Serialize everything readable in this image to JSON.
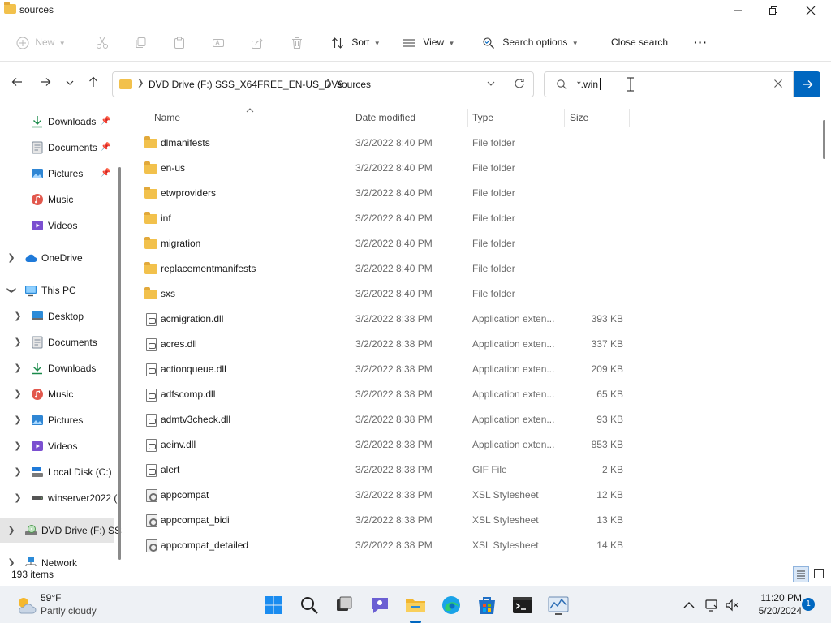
{
  "window": {
    "title": "sources"
  },
  "toolbar": {
    "new_label": "New",
    "sort_label": "Sort",
    "view_label": "View",
    "search_options_label": "Search options",
    "close_search_label": "Close search",
    "more_label": "···"
  },
  "address": {
    "crumbs": [
      "DVD Drive (F:) SSS_X64FREE_EN-US_DV9",
      "sources"
    ]
  },
  "search": {
    "value": "*.win"
  },
  "nav": {
    "items": [
      {
        "label": "Downloads",
        "icon": "download-arrow-icon",
        "pinned": true
      },
      {
        "label": "Documents",
        "icon": "documents-icon",
        "pinned": true
      },
      {
        "label": "Pictures",
        "icon": "pictures-icon",
        "pinned": true
      },
      {
        "label": "Music",
        "icon": "music-icon"
      },
      {
        "label": "Videos",
        "icon": "videos-icon"
      },
      {
        "label": "OneDrive",
        "icon": "cloud-icon"
      },
      {
        "label": "This PC",
        "icon": "monitor-icon"
      },
      {
        "label": "Desktop",
        "icon": "desktop-icon"
      },
      {
        "label": "Documents",
        "icon": "documents-icon"
      },
      {
        "label": "Downloads",
        "icon": "download-arrow-icon"
      },
      {
        "label": "Music",
        "icon": "music-icon"
      },
      {
        "label": "Pictures",
        "icon": "pictures-icon"
      },
      {
        "label": "Videos",
        "icon": "videos-icon"
      },
      {
        "label": "Local Disk (C:)",
        "icon": "disk-icon"
      },
      {
        "label": "winserver2022 (",
        "icon": "network-drive-icon"
      },
      {
        "label": "DVD Drive (F:) SSS",
        "icon": "dvd-drive-icon"
      },
      {
        "label": "Network",
        "icon": "network-icon"
      }
    ]
  },
  "columns": {
    "name": "Name",
    "date": "Date modified",
    "type": "Type",
    "size": "Size"
  },
  "files": [
    {
      "name": "dlmanifests",
      "date": "3/2/2022 8:40 PM",
      "type": "File folder",
      "size": "",
      "kind": "folder"
    },
    {
      "name": "en-us",
      "date": "3/2/2022 8:40 PM",
      "type": "File folder",
      "size": "",
      "kind": "folder"
    },
    {
      "name": "etwproviders",
      "date": "3/2/2022 8:40 PM",
      "type": "File folder",
      "size": "",
      "kind": "folder"
    },
    {
      "name": "inf",
      "date": "3/2/2022 8:40 PM",
      "type": "File folder",
      "size": "",
      "kind": "folder"
    },
    {
      "name": "migration",
      "date": "3/2/2022 8:40 PM",
      "type": "File folder",
      "size": "",
      "kind": "folder"
    },
    {
      "name": "replacementmanifests",
      "date": "3/2/2022 8:40 PM",
      "type": "File folder",
      "size": "",
      "kind": "folder"
    },
    {
      "name": "sxs",
      "date": "3/2/2022 8:40 PM",
      "type": "File folder",
      "size": "",
      "kind": "folder"
    },
    {
      "name": "acmigration.dll",
      "date": "3/2/2022 8:38 PM",
      "type": "Application exten...",
      "size": "393 KB",
      "kind": "dll"
    },
    {
      "name": "acres.dll",
      "date": "3/2/2022 8:38 PM",
      "type": "Application exten...",
      "size": "337 KB",
      "kind": "dll"
    },
    {
      "name": "actionqueue.dll",
      "date": "3/2/2022 8:38 PM",
      "type": "Application exten...",
      "size": "209 KB",
      "kind": "dll"
    },
    {
      "name": "adfscomp.dll",
      "date": "3/2/2022 8:38 PM",
      "type": "Application exten...",
      "size": "65 KB",
      "kind": "dll"
    },
    {
      "name": "admtv3check.dll",
      "date": "3/2/2022 8:38 PM",
      "type": "Application exten...",
      "size": "93 KB",
      "kind": "dll"
    },
    {
      "name": "aeinv.dll",
      "date": "3/2/2022 8:38 PM",
      "type": "Application exten...",
      "size": "853 KB",
      "kind": "dll"
    },
    {
      "name": "alert",
      "date": "3/2/2022 8:38 PM",
      "type": "GIF File",
      "size": "2 KB",
      "kind": "gif"
    },
    {
      "name": "appcompat",
      "date": "3/2/2022 8:38 PM",
      "type": "XSL Stylesheet",
      "size": "12 KB",
      "kind": "xsl"
    },
    {
      "name": "appcompat_bidi",
      "date": "3/2/2022 8:38 PM",
      "type": "XSL Stylesheet",
      "size": "13 KB",
      "kind": "xsl"
    },
    {
      "name": "appcompat_detailed",
      "date": "3/2/2022 8:38 PM",
      "type": "XSL Stylesheet",
      "size": "14 KB",
      "kind": "xsl"
    }
  ],
  "status": {
    "item_count": "193 items"
  },
  "taskbar": {
    "weather_temp": "59°F",
    "weather_desc": "Partly cloudy",
    "time": "11:20 PM",
    "date": "5/20/2024",
    "notification_count": "1"
  }
}
